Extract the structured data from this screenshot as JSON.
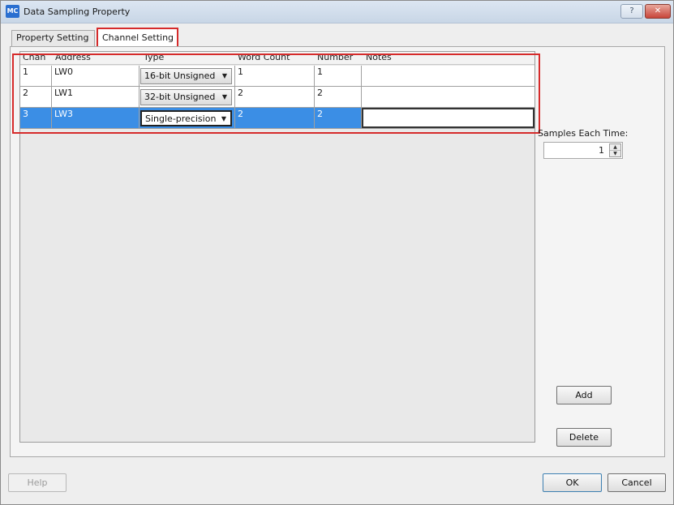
{
  "window": {
    "title": "Data Sampling Property",
    "icon": "MC",
    "help_glyph": "?",
    "close_glyph": "✕"
  },
  "tabs": [
    {
      "label": "Property Setting",
      "active": false
    },
    {
      "label": "Channel Setting",
      "active": true
    }
  ],
  "table": {
    "headers": {
      "chan": "Chan",
      "address": "Address",
      "type": "Type",
      "word_count": "Word Count",
      "number": "Number",
      "notes": "Notes"
    },
    "rows": [
      {
        "chan": "1",
        "address": "LW0",
        "type": "16-bit Unsigned",
        "word_count": "1",
        "number": "1",
        "notes": ""
      },
      {
        "chan": "2",
        "address": "LW1",
        "type": "32-bit Unsigned",
        "word_count": "2",
        "number": "2",
        "notes": ""
      },
      {
        "chan": "3",
        "address": "LW3",
        "type": "Single-precision",
        "word_count": "2",
        "number": "2",
        "notes": ""
      }
    ],
    "selected_row": 2
  },
  "samples": {
    "label": "Samples Each Time:",
    "value": "1"
  },
  "buttons": {
    "add": "Add",
    "delete": "Delete",
    "help": "Help",
    "ok": "OK",
    "cancel": "Cancel"
  },
  "colors": {
    "selection": "#3b8ee5",
    "annotation_outline": "#d62b2b"
  }
}
